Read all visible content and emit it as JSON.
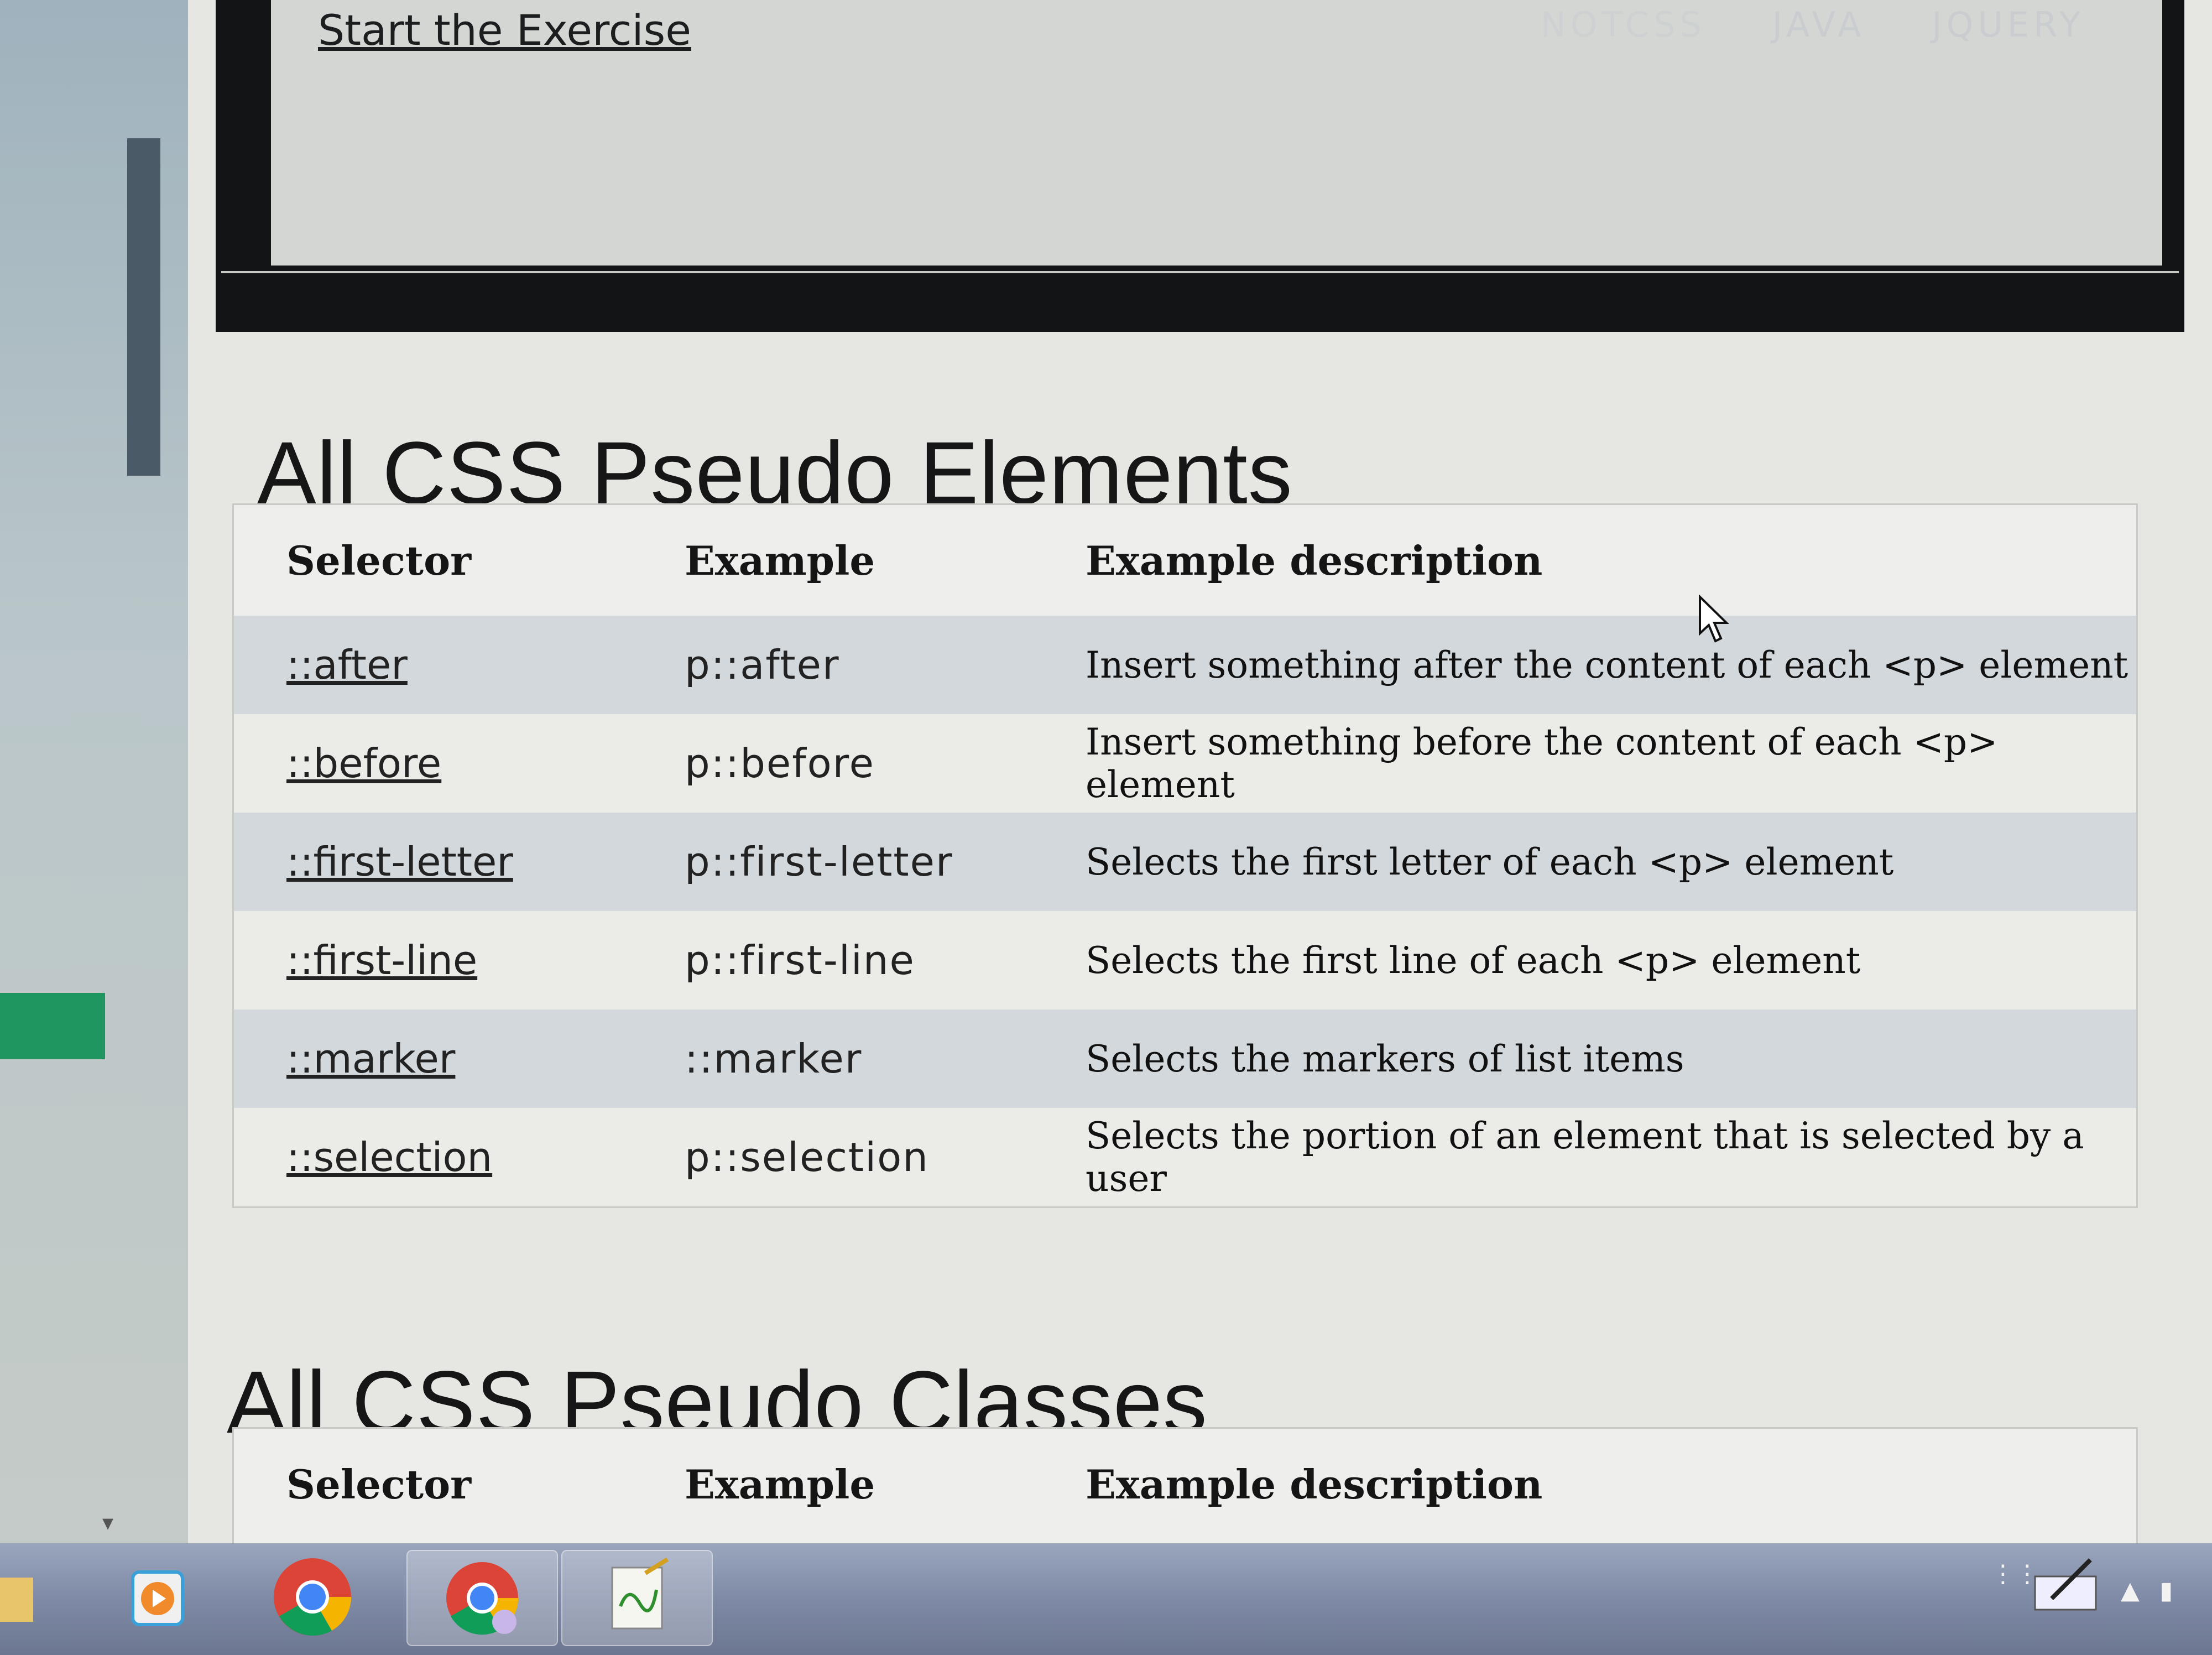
{
  "banner": {
    "exercise_link": "Start the Exercise",
    "nav": [
      "NOTCSS",
      "JAVA",
      "JQUERY"
    ]
  },
  "sections": {
    "elements_heading": "All CSS Pseudo Elements",
    "classes_heading": "All CSS Pseudo Classes"
  },
  "table_elements": {
    "headers": [
      "Selector",
      "Example",
      "Example description"
    ],
    "rows": [
      {
        "selector": "::after",
        "example": "p::after",
        "description": "Insert something after the content of each <p> element"
      },
      {
        "selector": "::before",
        "example": "p::before",
        "description": "Insert something before the content of each <p> element"
      },
      {
        "selector": "::first-letter",
        "example": "p::first-letter",
        "description": "Selects the first letter of each <p> element"
      },
      {
        "selector": "::first-line",
        "example": "p::first-line",
        "description": "Selects the first line of each <p> element"
      },
      {
        "selector": "::marker",
        "example": "::marker",
        "description": "Selects the markers of list items"
      },
      {
        "selector": "::selection",
        "example": "p::selection",
        "description": "Selects the portion of an element that is selected by a user"
      }
    ]
  },
  "table_classes": {
    "headers": [
      "Selector",
      "Example",
      "Example description"
    ]
  },
  "taskbar": {
    "apps": [
      "file-explorer-icon",
      "media-player-icon",
      "chrome-icon",
      "chrome-icon",
      "notepad-plus-plus-icon"
    ]
  },
  "colors": {
    "page_bg": "#e6e7e3",
    "odd_row": "#d2d8dc",
    "banner": "#121416",
    "green_tab": "#1f9560"
  }
}
